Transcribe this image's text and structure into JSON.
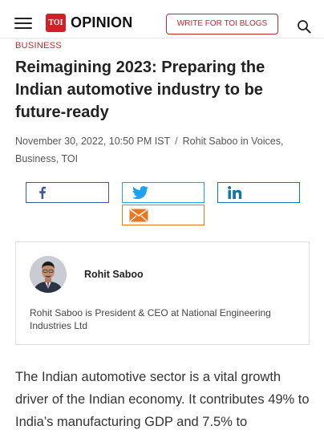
{
  "header": {
    "logo_text": "TOI",
    "section_title": "OPINION",
    "write_button_label": "WRITE FOR TOI BLOGS"
  },
  "article": {
    "category": "BUSINESS",
    "title": "Reimagining 2023: Preparing the Indian automotive industry to be future-ready",
    "date": "November 30, 2022, 10:50 PM IST",
    "separator": "/",
    "byline": "Rohit Saboo in Voices, Business, TOI",
    "body": "The Indian automotive sector is a vital growth driver of the Indian economy. It contributes 49% to India’s manufacturing GDP and 7.5% to"
  },
  "share": {
    "icons": [
      "facebook-icon",
      "twitter-icon",
      "linkedin-icon",
      "email-icon"
    ],
    "colors": {
      "facebook": "#3b5998",
      "twitter": "#1da1f2",
      "linkedin": "#0e76a8",
      "email": "#e87722"
    }
  },
  "author": {
    "name": "Rohit Saboo",
    "bio": "Rohit Saboo is President & CEO at National Engineering Industries Ltd"
  },
  "colors": {
    "brand_red": "#c8262e",
    "text": "#222222"
  }
}
